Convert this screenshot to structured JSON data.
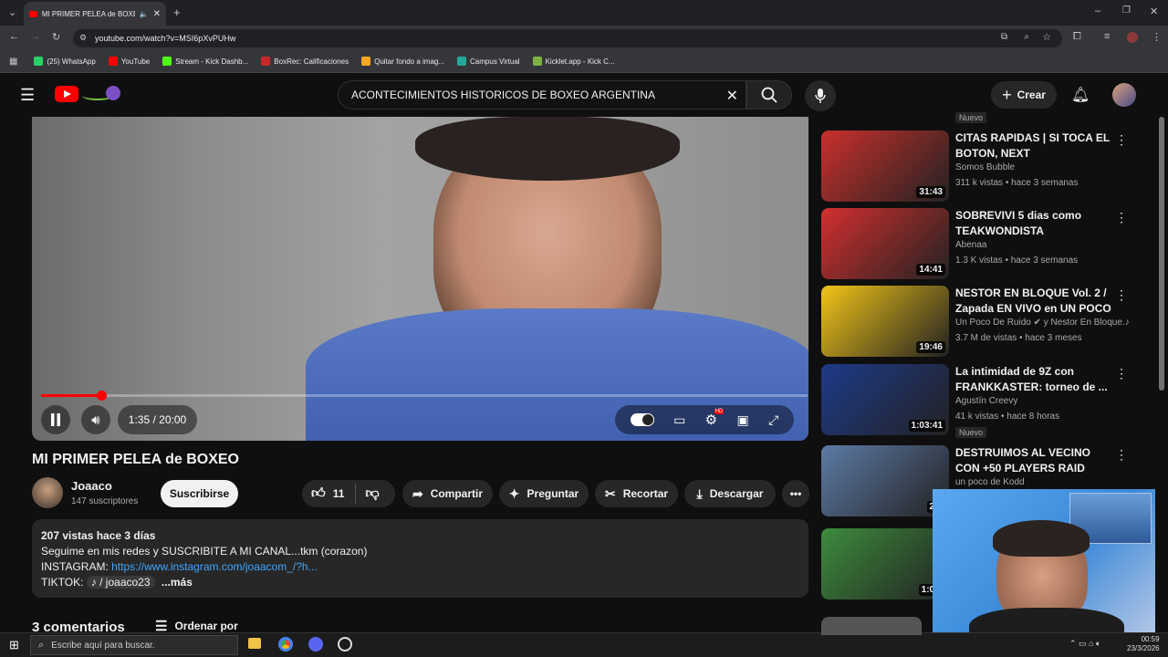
{
  "browser": {
    "tab_title": "MI PRIMER PELEA de BOXE",
    "url": "youtube.com/watch?v=MSI6pXvPUHw",
    "bookmarks": [
      {
        "label": "(25) WhatsApp",
        "color": "#25d366"
      },
      {
        "label": "YouTube",
        "color": "#ff0000"
      },
      {
        "label": "Stream - Kick Dashb...",
        "color": "#53fc18"
      },
      {
        "label": "BoxRec: Calificaciones",
        "color": "#c62828"
      },
      {
        "label": "Quitar fondo a imag...",
        "color": "#f9a825"
      },
      {
        "label": "Campus Virtual",
        "color": "#26a69a"
      },
      {
        "label": "Kicklet.app - Kick C...",
        "color": "#7cb342"
      }
    ]
  },
  "header": {
    "search_query": "ACONTECIMIENTOS HISTORICOS DE BOXEO ARGENTINA",
    "create_label": "Crear"
  },
  "player": {
    "time": "1:35 / 20:00",
    "progress": 0.079,
    "hd_badge": "HD"
  },
  "video": {
    "title": "MI PRIMER PELEA de BOXEO",
    "channel": "Joaaco",
    "subscribers": "147 suscriptores",
    "subscribe_label": "Suscribirse",
    "likes": "11",
    "share_label": "Compartir",
    "ask_label": "Preguntar",
    "clip_label": "Recortar",
    "download_label": "Descargar"
  },
  "description": {
    "stats": "207 vistas  hace 3 días",
    "line1": "Seguime en mis redes y SUSCRIBITE A MI CANAL...tkm (corazon)",
    "instagram_prefix": "INSTAGRAM: ",
    "instagram_link": "https://www.instagram.com/joaacom_/?h...",
    "tiktok_prefix": "TIKTOK: ",
    "tiktok_handle": "/ joaaco23",
    "more": "...más"
  },
  "comments": {
    "count_label": "3 comentarios",
    "sort_label": "Ordenar por"
  },
  "recommendations": {
    "top_badge": "Nuevo",
    "items": [
      {
        "title": "CITAS RAPIDAS | SI TOCA EL BOTON, NEXT",
        "channel": "Somos Bubble",
        "meta": "311 k vistas • hace 3 semanas",
        "duration": "31:43",
        "thumb_color": "#c9302c"
      },
      {
        "title": "SOBREVIVI 5 dias como TEAKWONDISTA PROFESION...",
        "channel": "Abenaa",
        "meta": "1.3 K vistas • hace 3 semanas",
        "duration": "14:41",
        "thumb_color": "#d32f2f"
      },
      {
        "title": "NESTOR EN BLOQUE Vol. 2 / Zapada EN VIVO en UN POCO ...",
        "channel": "Un Poco De Ruido ✔ y Nestor En Bloque.♪",
        "meta": "3.7 M de vistas • hace 3 meses",
        "duration": "19:46",
        "thumb_color": "#f2c417"
      },
      {
        "title": "La intimidad de 9Z con FRANKKASTER: torneo de ...",
        "channel": "Agustín Creevy",
        "meta": "41 k vistas • hace 8 horas",
        "duration": "1:03:41",
        "thumb_color": "#1e3a8a",
        "badge": "Nuevo"
      },
      {
        "title": "DESTRUIMOS AL VECINO CON +50 PLAYERS  RAID PROFIT| ...",
        "channel": "un poco de Kodd",
        "meta": "",
        "duration": "24:",
        "thumb_color": "#5d7ba6"
      },
      {
        "title": "",
        "channel": "",
        "meta": "",
        "duration": "1:00:",
        "thumb_color": "#3d8c3d"
      }
    ]
  },
  "taskbar": {
    "search_placeholder": "Escribe aquí para buscar.",
    "clock_time": "00:59",
    "clock_date": "23/3/2026"
  }
}
